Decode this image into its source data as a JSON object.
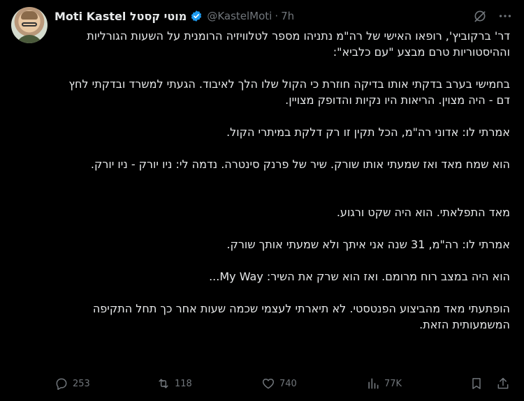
{
  "author": {
    "display_name": "Moti Kastel מוטי קסטל",
    "handle": "@KastelMoti",
    "separator": "·",
    "time": "7h",
    "verified": true
  },
  "tweet": {
    "paragraphs": [
      "דר' ברקוביץ', רופאו האישי של רה\"מ נתניהו מספר לטלוויזיה הרומנית על השעות הגורליות וההיסטוריות טרם מבצע \"עם כלביא\":",
      "בחמישי בערב בדקתי אותו בדיקה חוזרת כי הקול שלו הלך לאיבוד. הגעתי למשרד ובדקתי לחץ דם - היה מצוין. הריאות היו נקיות והדופק מצויין.",
      "אמרתי לו: אדוני רה\"מ, הכל תקין זו רק דלקת במיתרי הקול.",
      "הוא שמח מאד ואז שמעתי אותו שורק. שיר של פרנק סינטרה. נדמה לי: ניו יורק - ניו יורק.",
      "מאד התפלאתי. הוא היה שקט ורגוע.",
      "אמרתי לו: רה\"מ, 31 שנה אני איתך ולא שמעתי אותך שורק.",
      "הוא היה במצב רוח מרומם. ואז הוא שרק את השיר: My Way...",
      "הופתעתי מאד מהביצוע הפנטסטי. לא תיארתי לעצמי שכמה שעות אחר כך תחל התקיפה המשמעותית הזאת."
    ]
  },
  "actions": {
    "replies": "253",
    "reposts": "118",
    "likes": "740",
    "views": "77K"
  },
  "icons": [
    "grok-icon",
    "more-icon",
    "reply-icon",
    "repost-icon",
    "like-icon",
    "views-icon",
    "bookmark-icon",
    "share-icon"
  ],
  "colors": {
    "background": "#000000",
    "text": "#e7e9ea",
    "muted": "#71767b",
    "verified": "#1d9bf0"
  }
}
